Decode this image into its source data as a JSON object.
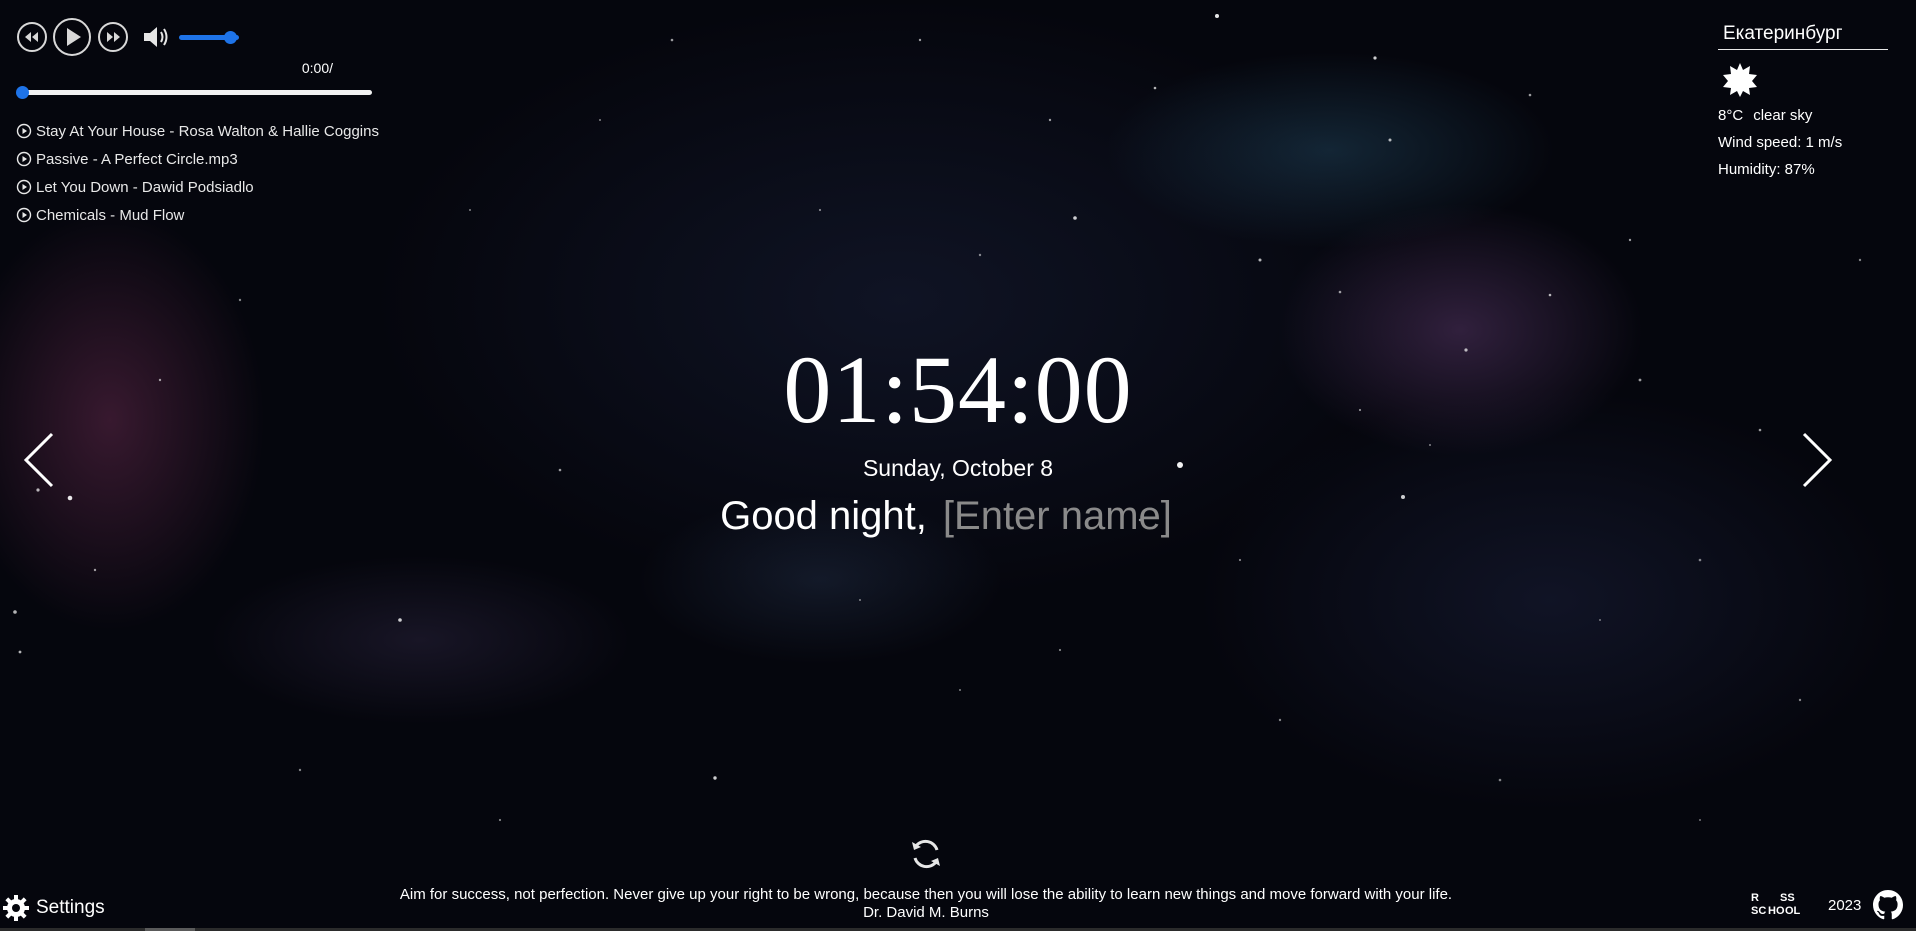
{
  "player": {
    "time_display": "0:00/",
    "volume_level": 0.85,
    "progress": 0,
    "playlist": [
      {
        "title": "Stay At Your House - Rosa Walton & Hallie Coggins"
      },
      {
        "title": "Passive - A Perfect Circle.mp3"
      },
      {
        "title": "Let You Down - Dawid Podsiadlo"
      },
      {
        "title": "Chemicals - Mud Flow"
      }
    ]
  },
  "weather": {
    "city": "Екатеринбург",
    "icon": "clear-sky-icon",
    "temperature": "8°C",
    "description": "clear sky",
    "wind": "Wind speed: 1 m/s",
    "humidity": "Humidity: 87%"
  },
  "clock": {
    "time": "01:54:00",
    "date": "Sunday, October 8"
  },
  "greeting": {
    "text": "Good night,",
    "name_placeholder": "[Enter name]",
    "name_value": ""
  },
  "quote": {
    "text": "Aim for success, not perfection. Never give up your right to be wrong, because then you will lose the ability to learn new things and move forward with your life.",
    "author": "Dr. David M. Burns"
  },
  "footer": {
    "settings_label": "Settings",
    "logo_lines": [
      "R",
      "SS",
      "SC",
      "HO",
      "OL"
    ],
    "year": "2023"
  },
  "colors": {
    "accent": "#1e73e8",
    "text": "#ffffff",
    "placeholder": "#8a8a8a"
  }
}
